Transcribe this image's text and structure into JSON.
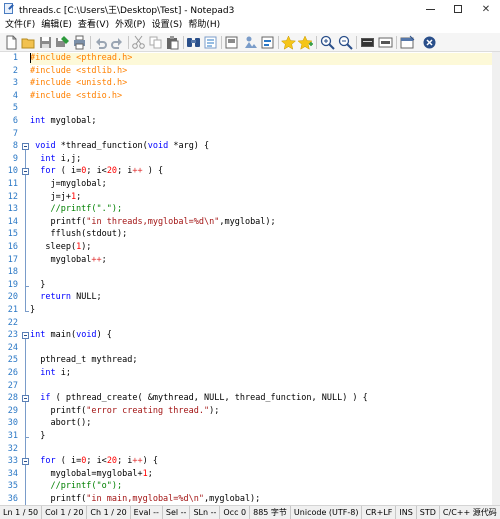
{
  "window": {
    "title": "threads.c [C:\\Users\\王\\Desktop\\Test] - Notepad3",
    "minimize_glyph": "",
    "maximize_glyph": "",
    "close_glyph": "✕"
  },
  "menu": [
    {
      "label": "文件(F)"
    },
    {
      "label": "编辑(E)"
    },
    {
      "label": "查看(V)"
    },
    {
      "label": "外观(P)"
    },
    {
      "label": "设置(S)"
    },
    {
      "label": "帮助(H)"
    }
  ],
  "toolbar": {
    "icons": [
      "new-file-icon",
      "open-icon",
      "save-icon",
      "save-as-icon",
      "print-icon",
      "undo-icon",
      "redo-icon",
      "cut-icon",
      "copy-icon",
      "paste-icon",
      "find-icon",
      "replace-icon",
      "save-copy-icon",
      "select-all-icon",
      "goto-icon",
      "add-favorite-icon",
      "favorites-icon",
      "zoom-in-icon",
      "zoom-out-icon",
      "schemes-icon",
      "customize-icon",
      "new-window-icon",
      "exit-icon"
    ]
  },
  "editor": {
    "lines": [
      {
        "n": "1",
        "t": "#include <pthread.h>"
      },
      {
        "n": "2",
        "t": "#include <stdlib.h>"
      },
      {
        "n": "3",
        "t": "#include <unistd.h>"
      },
      {
        "n": "4",
        "t": "#include <stdio.h>"
      },
      {
        "n": "5",
        "t": ""
      },
      {
        "n": "6",
        "t": "int myglobal;"
      },
      {
        "n": "7",
        "t": ""
      },
      {
        "n": "8",
        "t": " void *thread_function(void *arg) {"
      },
      {
        "n": "9",
        "t": "  int i,j;"
      },
      {
        "n": "10",
        "t": "  for ( i=0; i<20; i++ ) {"
      },
      {
        "n": "11",
        "t": "    j=myglobal;"
      },
      {
        "n": "12",
        "t": "    j=j+1;"
      },
      {
        "n": "13",
        "t": "    //printf(\".\");"
      },
      {
        "n": "14",
        "t": "    printf(\"in threads,myglobal=%d\\n\",myglobal);"
      },
      {
        "n": "15",
        "t": "    fflush(stdout);"
      },
      {
        "n": "16",
        "t": "   sleep(1);"
      },
      {
        "n": "17",
        "t": "    myglobal++;"
      },
      {
        "n": "18",
        "t": ""
      },
      {
        "n": "19",
        "t": "  }"
      },
      {
        "n": "20",
        "t": "  return NULL;"
      },
      {
        "n": "21",
        "t": "}"
      },
      {
        "n": "22",
        "t": ""
      },
      {
        "n": "23",
        "t": "int main(void) {"
      },
      {
        "n": "24",
        "t": ""
      },
      {
        "n": "25",
        "t": "  pthread_t mythread;"
      },
      {
        "n": "26",
        "t": "  int i;"
      },
      {
        "n": "27",
        "t": ""
      },
      {
        "n": "28",
        "t": "  if ( pthread_create( &mythread, NULL, thread_function, NULL) ) {"
      },
      {
        "n": "29",
        "t": "    printf(\"error creating thread.\");"
      },
      {
        "n": "30",
        "t": "    abort();"
      },
      {
        "n": "31",
        "t": "  }"
      },
      {
        "n": "32",
        "t": ""
      },
      {
        "n": "33",
        "t": "  for ( i=0; i<20; i++) {"
      },
      {
        "n": "34",
        "t": "    myglobal=myglobal+1;"
      },
      {
        "n": "35",
        "t": "    //printf(\"o\");"
      },
      {
        "n": "36",
        "t": "    printf(\"in main,myglobal=%d\\n\",myglobal);"
      }
    ]
  },
  "status": {
    "ln": "Ln 1 / 50",
    "col": "Col 1 / 20",
    "ch": "Ch 1 / 20",
    "eval": "Eval  --",
    "sel": "Sel  --",
    "sln": "SLn  --",
    "occ": "Occ  0",
    "size": "885 字节",
    "encoding": "Unicode (UTF-8)",
    "eol": "CR+LF",
    "ins": "INS",
    "std": "STD",
    "lexer": "C/C++ 源代码"
  },
  "colors": {
    "line_number": "#2b78c5",
    "keyword": "#0000ff",
    "preprocessor": "#ff8000",
    "string": "#a31515",
    "number": "#ff0000",
    "comment": "#008000",
    "current_line": "#fdf9d8"
  }
}
